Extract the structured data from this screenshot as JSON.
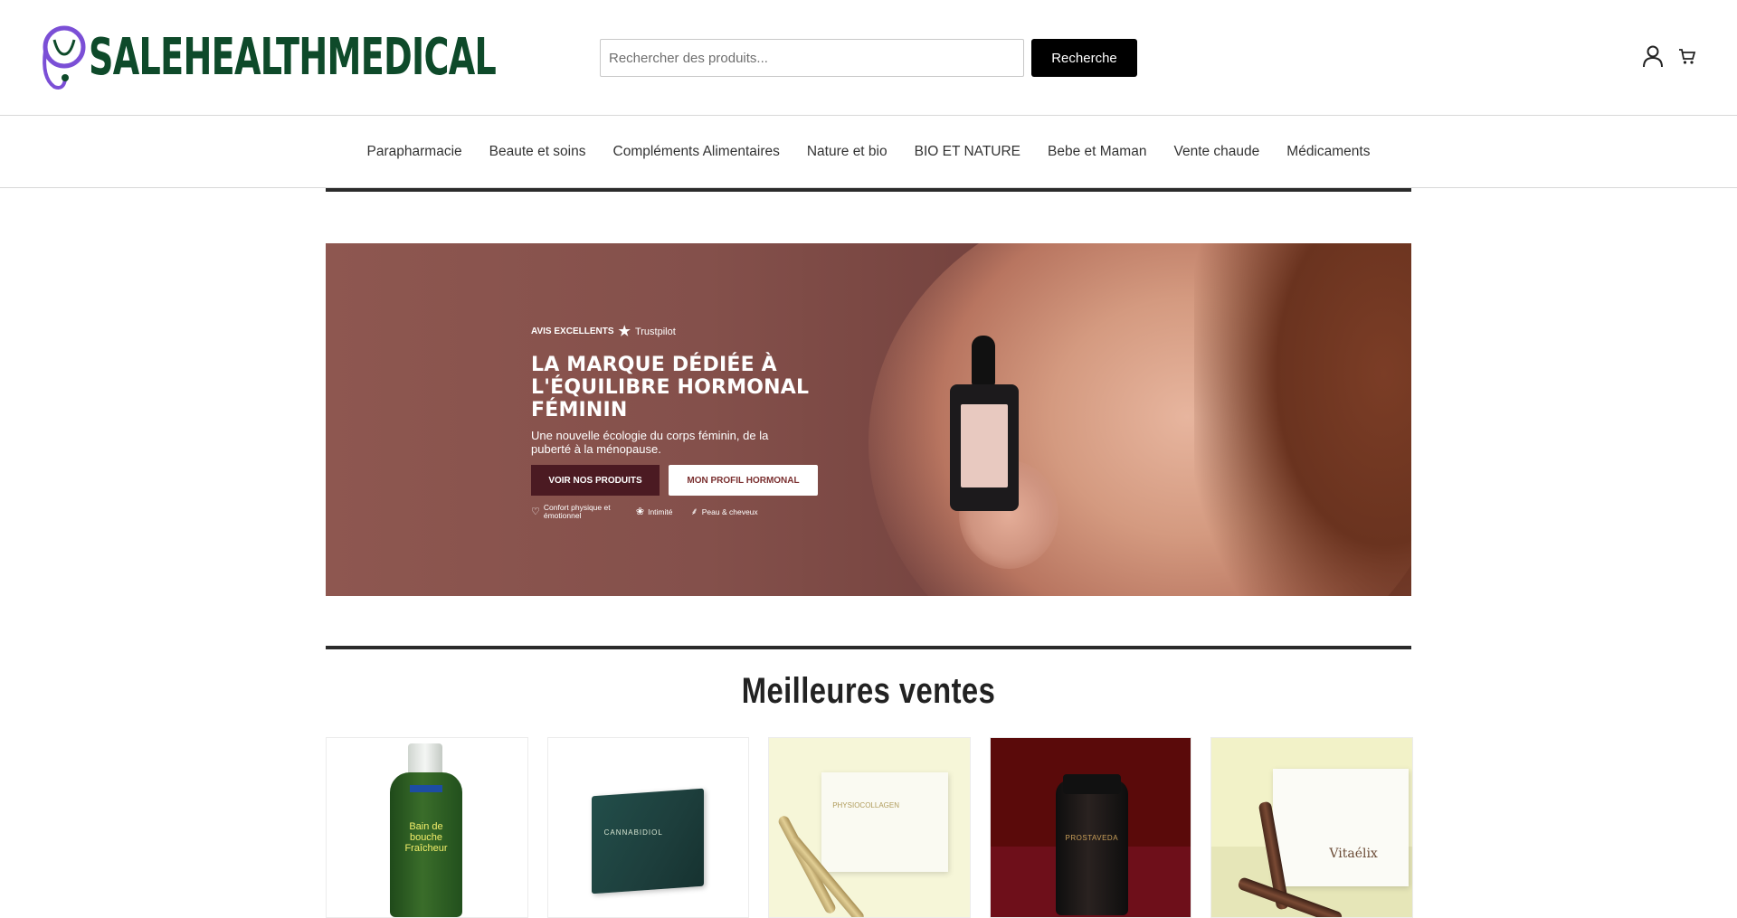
{
  "header": {
    "logo_text": "SALEHEALTHMEDICAL",
    "search_placeholder": "Rechercher des produits...",
    "search_button": "Recherche",
    "account_icon": "user-icon",
    "cart_icon": "cart-icon"
  },
  "nav": {
    "items": [
      {
        "label": "Parapharmacie"
      },
      {
        "label": "Beaute et soins"
      },
      {
        "label": "Compléments Alimentaires"
      },
      {
        "label": "Nature et bio"
      },
      {
        "label": "BIO ET NATURE"
      },
      {
        "label": "Bebe et Maman"
      },
      {
        "label": "Vente chaude"
      },
      {
        "label": "Médicaments"
      }
    ]
  },
  "banner": {
    "trust_label": "AVIS EXCELLENTS",
    "trust_brand": "Trustpilot",
    "title": "LA MARQUE DÉDIÉE À L'ÉQUILIBRE HORMONAL FÉMININ",
    "subtitle": "Une nouvelle écologie du corps féminin, de la puberté à la ménopause.",
    "cta_primary": "VOIR NOS PRODUITS",
    "cta_secondary": "MON PROFIL HORMONAL",
    "features": [
      {
        "icon": "heart-icon",
        "label": "Confort physique et émotionnel"
      },
      {
        "icon": "lotus-icon",
        "label": "Intimité"
      },
      {
        "icon": "feather-icon",
        "label": "Peau & cheveux"
      }
    ]
  },
  "best_sellers": {
    "title": "Meilleures ventes",
    "products": [
      {
        "name": "bain-de-bouche-fraicheur",
        "label_line1": "Bain de bouche",
        "label_line2": "Fraîcheur"
      },
      {
        "name": "cannabidiol-box",
        "label_line1": "CANNABIDIOL"
      },
      {
        "name": "physiocollagen",
        "label_line1": "PHYSIOCOLLAGEN"
      },
      {
        "name": "prostaveda",
        "label_line1": "PROSTAVEDA"
      },
      {
        "name": "vitaelix",
        "label_line1": "Vitaélix"
      }
    ]
  },
  "colors": {
    "brand_green": "#0e4a2a",
    "brand_purple": "#7b4fd6",
    "button_black": "#000000",
    "banner_primary_button": "#4b1a22"
  }
}
